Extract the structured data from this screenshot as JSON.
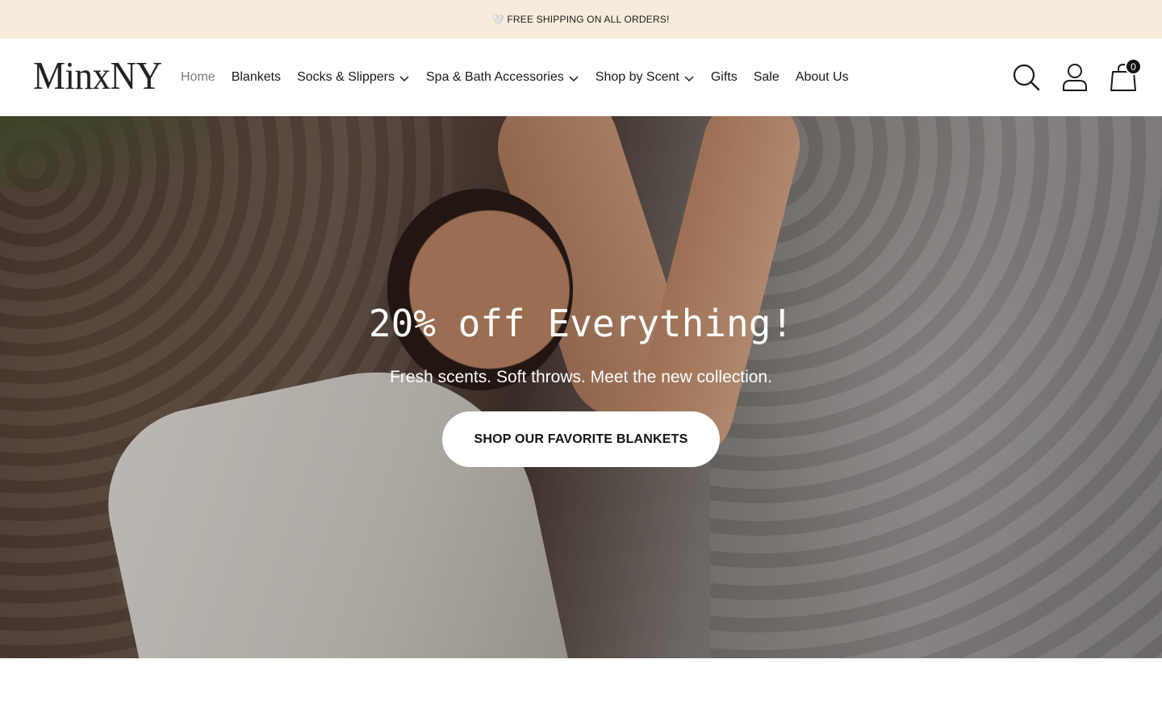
{
  "announcement": {
    "icon": "heart-icon",
    "heart": "🤍",
    "text": "FREE SHIPPING ON ALL ORDERS!"
  },
  "header": {
    "logo": "MinxNY",
    "nav": [
      {
        "label": "Home",
        "dropdown": false,
        "active": true
      },
      {
        "label": "Blankets",
        "dropdown": false
      },
      {
        "label": "Socks & Slippers",
        "dropdown": true
      },
      {
        "label": "Spa & Bath Accessories",
        "dropdown": true
      },
      {
        "label": "Shop by Scent",
        "dropdown": true
      },
      {
        "label": "Gifts",
        "dropdown": false
      },
      {
        "label": "Sale",
        "dropdown": false
      },
      {
        "label": "About Us",
        "dropdown": false
      }
    ],
    "icons": [
      "search-icon",
      "account-icon",
      "cart-icon"
    ],
    "cart_count": "0"
  },
  "hero": {
    "title": "20% off Everything!",
    "subtitle": "Fresh scents. Soft throws. Meet the new collection.",
    "button_label": "SHOP OUR FAVORITE BLANKETS"
  },
  "colors": {
    "announcement_bg": "#f7ecdb",
    "nav_active": "#7a7a7a",
    "text": "#1a1a1a",
    "button_bg": "#ffffff"
  }
}
